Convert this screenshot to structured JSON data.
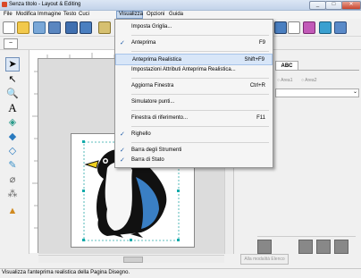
{
  "window": {
    "title": "Senza titolo - Layout & Editing",
    "minimize": "_",
    "maximize": "□",
    "close": "✕"
  },
  "menubar": [
    {
      "label": "File"
    },
    {
      "label": "Modifica"
    },
    {
      "label": "Immagine"
    },
    {
      "label": "Testo"
    },
    {
      "label": "Cuci"
    },
    {
      "label": "Visualizza"
    },
    {
      "label": "Opzioni"
    },
    {
      "label": "Guida"
    }
  ],
  "dropdown": {
    "items": [
      {
        "label": "Imposta Griglia...",
        "shortcut": "",
        "checked": false
      },
      {
        "label": "Anteprima",
        "shortcut": "F9",
        "checked": true
      },
      {
        "label": "Anteprima Realistica",
        "shortcut": "Shift+F9",
        "checked": false
      },
      {
        "label": "Impostazioni Attributi Anteprima Realistica...",
        "shortcut": "",
        "checked": false
      },
      {
        "label": "Aggiorna Finestra",
        "shortcut": "Ctrl+R",
        "checked": false
      },
      {
        "label": "Simulatore punti...",
        "shortcut": "",
        "checked": false
      },
      {
        "label": "Finestra di riferimento...",
        "shortcut": "F11",
        "checked": false
      },
      {
        "label": "Righello",
        "shortcut": "",
        "checked": true
      },
      {
        "label": "Barra degli Strumenti",
        "shortcut": "",
        "checked": true
      },
      {
        "label": "Barra di Stato",
        "shortcut": "",
        "checked": true
      }
    ],
    "check_glyph": "✓"
  },
  "right_panel": {
    "tab_label": "ABC",
    "radio1": "Area1",
    "radio2": "Area2",
    "apply_button": "Alla modalità Elenco"
  },
  "toolbar2": {
    "icon": "wave-icon"
  },
  "status_bar": {
    "text": "Visualizza l'anteprima realistica della Pagina Disegno."
  },
  "colors": {
    "accent_highlight": "#d8e6f8",
    "penguin_blue": "#3a7fc4",
    "penguin_black": "#111111",
    "beak_yellow": "#f0d020"
  }
}
